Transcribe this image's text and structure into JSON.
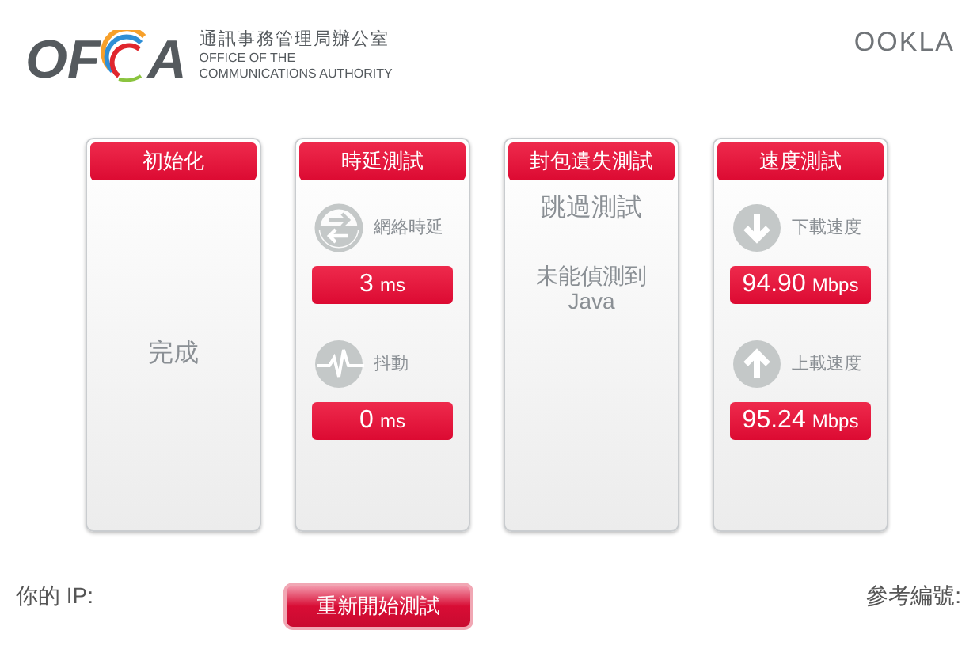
{
  "logo": {
    "mark_left": "OF",
    "mark_right": "A",
    "name_zh": "通訊事務管理局辦公室",
    "name_en": [
      "OFFICE OF THE",
      "COMMUNICATIONS AUTHORITY"
    ]
  },
  "partner_logo": "OOKLA",
  "panels": [
    {
      "title": "初始化",
      "kind": "status",
      "text": "完成"
    },
    {
      "title": "時延測試",
      "kind": "metrics",
      "metrics": [
        {
          "kind": "exchange",
          "label": "網絡時延",
          "value": "3",
          "unit": "ms"
        },
        {
          "kind": "pulse",
          "label": "抖動",
          "value": "0",
          "unit": "ms"
        }
      ]
    },
    {
      "title": "封包遺失測試",
      "kind": "skipped",
      "text": "跳過測試",
      "note": [
        "未能偵測到",
        "Java"
      ]
    },
    {
      "title": "速度測試",
      "kind": "metrics",
      "metrics": [
        {
          "kind": "down",
          "label": "下載速度",
          "value": "94.90",
          "unit": "Mbps"
        },
        {
          "kind": "up",
          "label": "上載速度",
          "value": "95.24",
          "unit": "Mbps"
        }
      ]
    }
  ],
  "footer": {
    "ip_label": "你的 IP:",
    "restart_button": "重新開始測試",
    "reference_label": "參考編號:"
  }
}
